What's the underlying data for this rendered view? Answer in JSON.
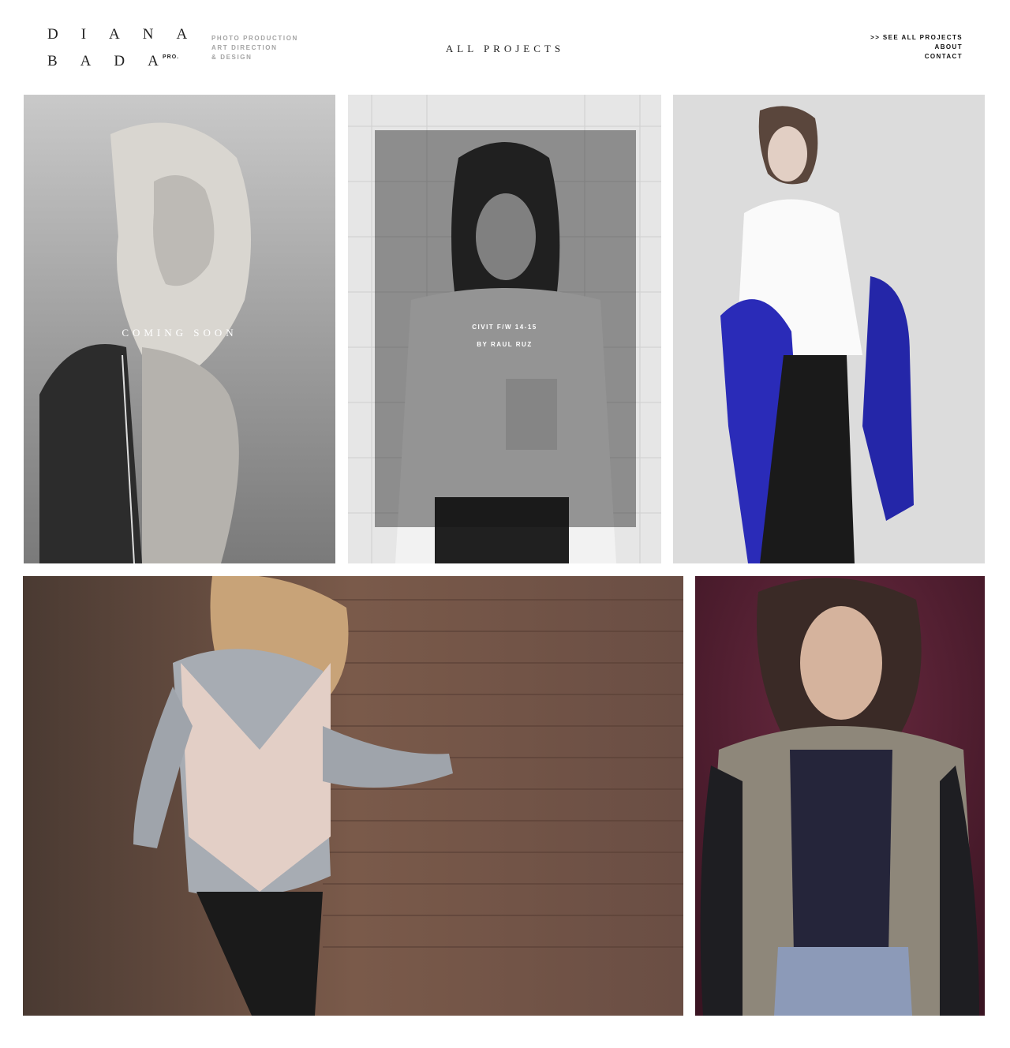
{
  "brand": {
    "line1": "DIANA",
    "line2": "BADA",
    "suffix": "PRO."
  },
  "tagline": [
    "PHOTO PRODUCTION",
    "ART DIRECTION",
    "& DESIGN"
  ],
  "page_title": "ALL PROJECTS",
  "nav": {
    "see_all": ">> SEE ALL PROJECTS",
    "about": "ABOUT",
    "contact": "CONTACT"
  },
  "projects": [
    {
      "overlay": "COMING SOON",
      "photo": "bw-portrait-blonde-zip-top"
    },
    {
      "title": "CIVIT F/W 14-15",
      "credit": "BY RAUL RUZ",
      "photo": "bw-portrait-bangs-white-blouse"
    },
    {
      "photo": "model-white-blouse-blue-coat"
    },
    {
      "photo": "model-brick-wall-grey-top"
    },
    {
      "photo": "model-patterned-jacket-burgundy"
    }
  ],
  "colors": {
    "text": "#111111",
    "muted": "#a4a4a4",
    "accent_blue": "#2a2bb8",
    "burgundy": "#4e1c2e"
  }
}
